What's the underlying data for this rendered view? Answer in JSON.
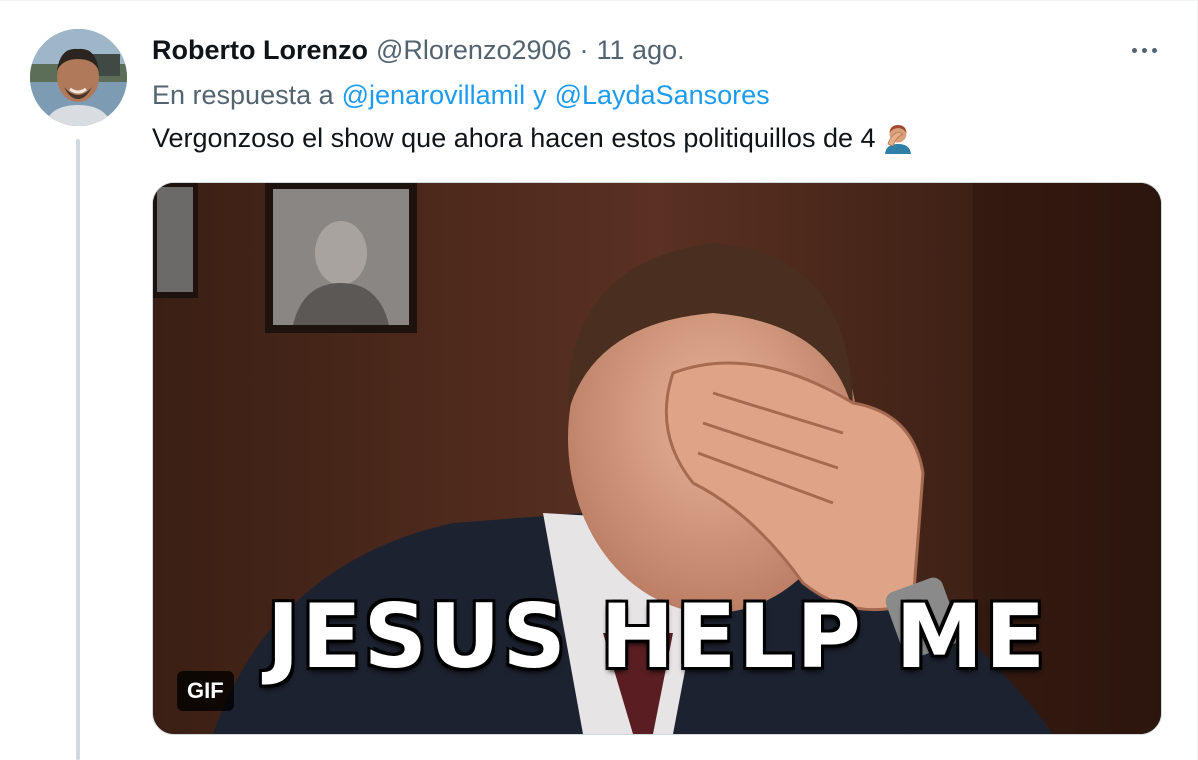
{
  "tweet": {
    "author_name": "Roberto Lorenzo",
    "author_handle": "@Rlorenzo2906",
    "separator": "·",
    "timestamp": "11 ago.",
    "reply_prefix": "En respuesta a",
    "reply_mentions": [
      "@jenarovillamil",
      "@LaydaSansores"
    ],
    "reply_conjunction": "y",
    "text": "Vergonzoso el show que ahora hacen estos politiquillos de 4",
    "emoji": "man-facepalming-emoji"
  },
  "media": {
    "caption": "JESUS HELP ME",
    "badge": "GIF"
  },
  "icons": {
    "more": "more-options-icon"
  },
  "colors": {
    "accent": "#1d9bf0",
    "secondary_text": "#536471",
    "thread_line": "#cfd9de"
  }
}
